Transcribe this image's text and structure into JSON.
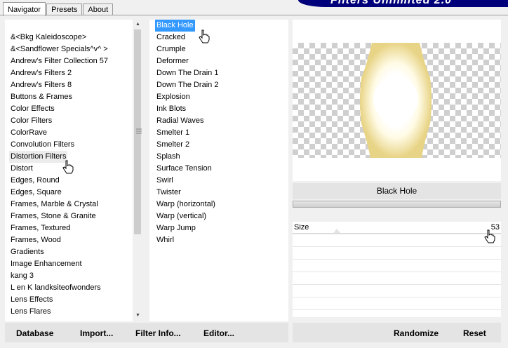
{
  "tabs": [
    "Navigator",
    "Presets",
    "About"
  ],
  "banner_title": "Filters Unlimited 2.0",
  "categories": [
    "&<Bkg Kaleidoscope>",
    "&<Sandflower Specials^v^ >",
    "Andrew's Filter Collection 57",
    "Andrew's Filters 2",
    "Andrew's Filters 8",
    "Buttons & Frames",
    "Color Effects",
    "Color Filters",
    "ColorRave",
    "Convolution Filters",
    "Distortion Filters",
    "Distort",
    "Edges, Round",
    "Edges, Square",
    "Frames, Marble & Crystal",
    "Frames, Stone & Granite",
    "Frames, Textured",
    "Frames, Wood",
    "Gradients",
    "Image Enhancement",
    "kang 3",
    "L en K landksiteofwonders",
    "Lens Effects",
    "Lens Flares"
  ],
  "hovered_category": "Distortion Filters",
  "filters": [
    "Black Hole",
    "Cracked",
    "Crumple",
    "Deformer",
    "Down The Drain 1",
    "Down The Drain 2",
    "Explosion",
    "Ink Blots",
    "Radial Waves",
    "Smelter 1",
    "Smelter 2",
    "Splash",
    "Surface Tension",
    "Swirl",
    "Twister",
    "Warp (horizontal)",
    "Warp (vertical)",
    "Warp Jump",
    "Whirl"
  ],
  "selected_filter": "Black Hole",
  "filter_title": "Black Hole",
  "param": {
    "label": "Size",
    "value": "53"
  },
  "buttons": {
    "database": "Database",
    "import": "Import...",
    "filter_info": "Filter Info...",
    "editor": "Editor...",
    "randomize": "Randomize",
    "reset": "Reset"
  },
  "colors": {
    "selection": "#3399ff",
    "banner": "#00007a",
    "preview_ring": "#f2e3a0"
  },
  "icons": [
    "hand-cursor-icon",
    "scroll-up-arrow-icon",
    "scroll-down-arrow-icon",
    "scroll-grip-icon"
  ]
}
